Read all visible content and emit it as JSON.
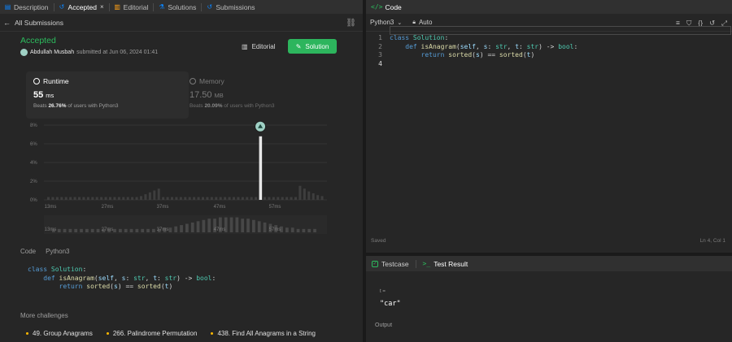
{
  "tabs": [
    {
      "label": "Description",
      "icon": "description-icon"
    },
    {
      "label": "Accepted",
      "icon": "history-icon",
      "active": true,
      "close": "×"
    },
    {
      "label": "Editorial",
      "icon": "book-icon"
    },
    {
      "label": "Solutions",
      "icon": "flask-icon"
    },
    {
      "label": "Submissions",
      "icon": "history-icon"
    }
  ],
  "back": {
    "label": "All Submissions"
  },
  "submission": {
    "status": "Accepted",
    "user": "Abdullah Musbah",
    "submitted_text": "submitted at Jun 06, 2024 01:41",
    "editorial_label": "Editorial",
    "solution_label": "Solution"
  },
  "runtime": {
    "title": "Runtime",
    "value": "55",
    "unit": "ms",
    "beats_prefix": "Beats",
    "beats_pct": "26.76%",
    "beats_suffix": "of users with Python3"
  },
  "memory": {
    "title": "Memory",
    "value": "17.50",
    "unit": "MB",
    "beats_prefix": "Beats",
    "beats_pct": "20.09%",
    "beats_suffix": "of users with Python3"
  },
  "chart_data": {
    "type": "bar",
    "y_ticks": [
      "8%",
      "6%",
      "4%",
      "2%",
      "0%"
    ],
    "ylim": [
      0,
      8
    ],
    "x_ticks": [
      "13ms",
      "27ms",
      "37ms",
      "47ms",
      "57ms"
    ],
    "values": [
      0.3,
      0.3,
      0.3,
      0.3,
      0.3,
      0.3,
      0.3,
      0.3,
      0.3,
      0.3,
      0.3,
      0.3,
      0.3,
      0.3,
      0.3,
      0.3,
      0.3,
      0.3,
      0.3,
      0.3,
      0.3,
      0.4,
      0.6,
      0.8,
      1.0,
      1.2,
      0.3,
      0.3,
      0.3,
      0.3,
      0.3,
      0.3,
      0.3,
      0.3,
      0.3,
      0.3,
      0.3,
      0.3,
      0.3,
      0.3,
      0.3,
      0.3,
      0.3,
      0.3,
      0.3,
      0.3,
      0.3,
      0.3,
      6.8,
      0.3,
      0.3,
      0.3,
      0.3,
      0.3,
      0.3,
      0.3,
      0.3,
      1.5,
      1.2,
      0.9,
      0.7,
      0.5,
      0.4
    ],
    "highlight_index": 48,
    "mini_x_ticks": [
      "13ms",
      "27ms",
      "37ms",
      "47ms",
      "57ms"
    ],
    "mini_values": [
      0.2,
      0.2,
      0.2,
      0.2,
      0.2,
      0.2,
      0.2,
      0.2,
      0.2,
      0.2,
      0.2,
      0.2,
      0.2,
      0.2,
      0.2,
      0.2,
      0.2,
      0.2,
      0.2,
      0.2,
      0.3,
      0.3,
      0.4,
      0.5,
      0.6,
      0.7,
      0.8,
      0.9,
      1.0,
      1.0,
      1.1,
      1.1,
      1.1,
      1.1,
      1.0,
      1.0,
      0.9,
      0.8,
      0.7,
      0.6,
      0.5,
      0.4,
      0.3,
      0.3,
      0.2,
      0.2,
      0.2,
      0.2
    ]
  },
  "code_section": {
    "label": "Code",
    "lang": "Python3"
  },
  "code_lines": [
    [
      {
        "t": "class ",
        "c": "kw"
      },
      {
        "t": "Solution",
        "c": "cls"
      },
      {
        "t": ":",
        "c": ""
      }
    ],
    [
      {
        "t": "    def ",
        "c": "kw"
      },
      {
        "t": "isAnagram",
        "c": "fn"
      },
      {
        "t": "(",
        "c": ""
      },
      {
        "t": "self",
        "c": "pm"
      },
      {
        "t": ", ",
        "c": ""
      },
      {
        "t": "s",
        "c": "pm"
      },
      {
        "t": ": ",
        "c": ""
      },
      {
        "t": "str",
        "c": "ty"
      },
      {
        "t": ", ",
        "c": ""
      },
      {
        "t": "t",
        "c": "pm"
      },
      {
        "t": ": ",
        "c": ""
      },
      {
        "t": "str",
        "c": "ty"
      },
      {
        "t": ") -> ",
        "c": ""
      },
      {
        "t": "bool",
        "c": "ty"
      },
      {
        "t": ":",
        "c": ""
      }
    ],
    [
      {
        "t": "        return ",
        "c": "kw"
      },
      {
        "t": "sorted",
        "c": "bi"
      },
      {
        "t": "(",
        "c": ""
      },
      {
        "t": "s",
        "c": "pm"
      },
      {
        "t": ") == ",
        "c": ""
      },
      {
        "t": "sorted",
        "c": "bi"
      },
      {
        "t": "(",
        "c": ""
      },
      {
        "t": "t",
        "c": "pm"
      },
      {
        "t": ")",
        "c": ""
      }
    ]
  ],
  "more": {
    "title": "More challenges",
    "items": [
      "49. Group Anagrams",
      "266. Palindrome Permutation",
      "438. Find All Anagrams in a String"
    ]
  },
  "editor": {
    "title": "Code",
    "lang": "Python3",
    "mode": "Auto",
    "line_numbers": [
      "1",
      "2",
      "3",
      "4"
    ],
    "saved": "Saved",
    "position": "Ln 4, Col 1"
  },
  "testcase": {
    "tab1": "Testcase",
    "tab2": "Test Result",
    "var_label": "t =",
    "var_value": "\"car\"",
    "output_label": "Output"
  },
  "colors": {
    "accent": "#2cbb5d",
    "bar": "#3e3e3e",
    "highlight": "#e8e8e8",
    "medal": "#9fd0c4"
  }
}
